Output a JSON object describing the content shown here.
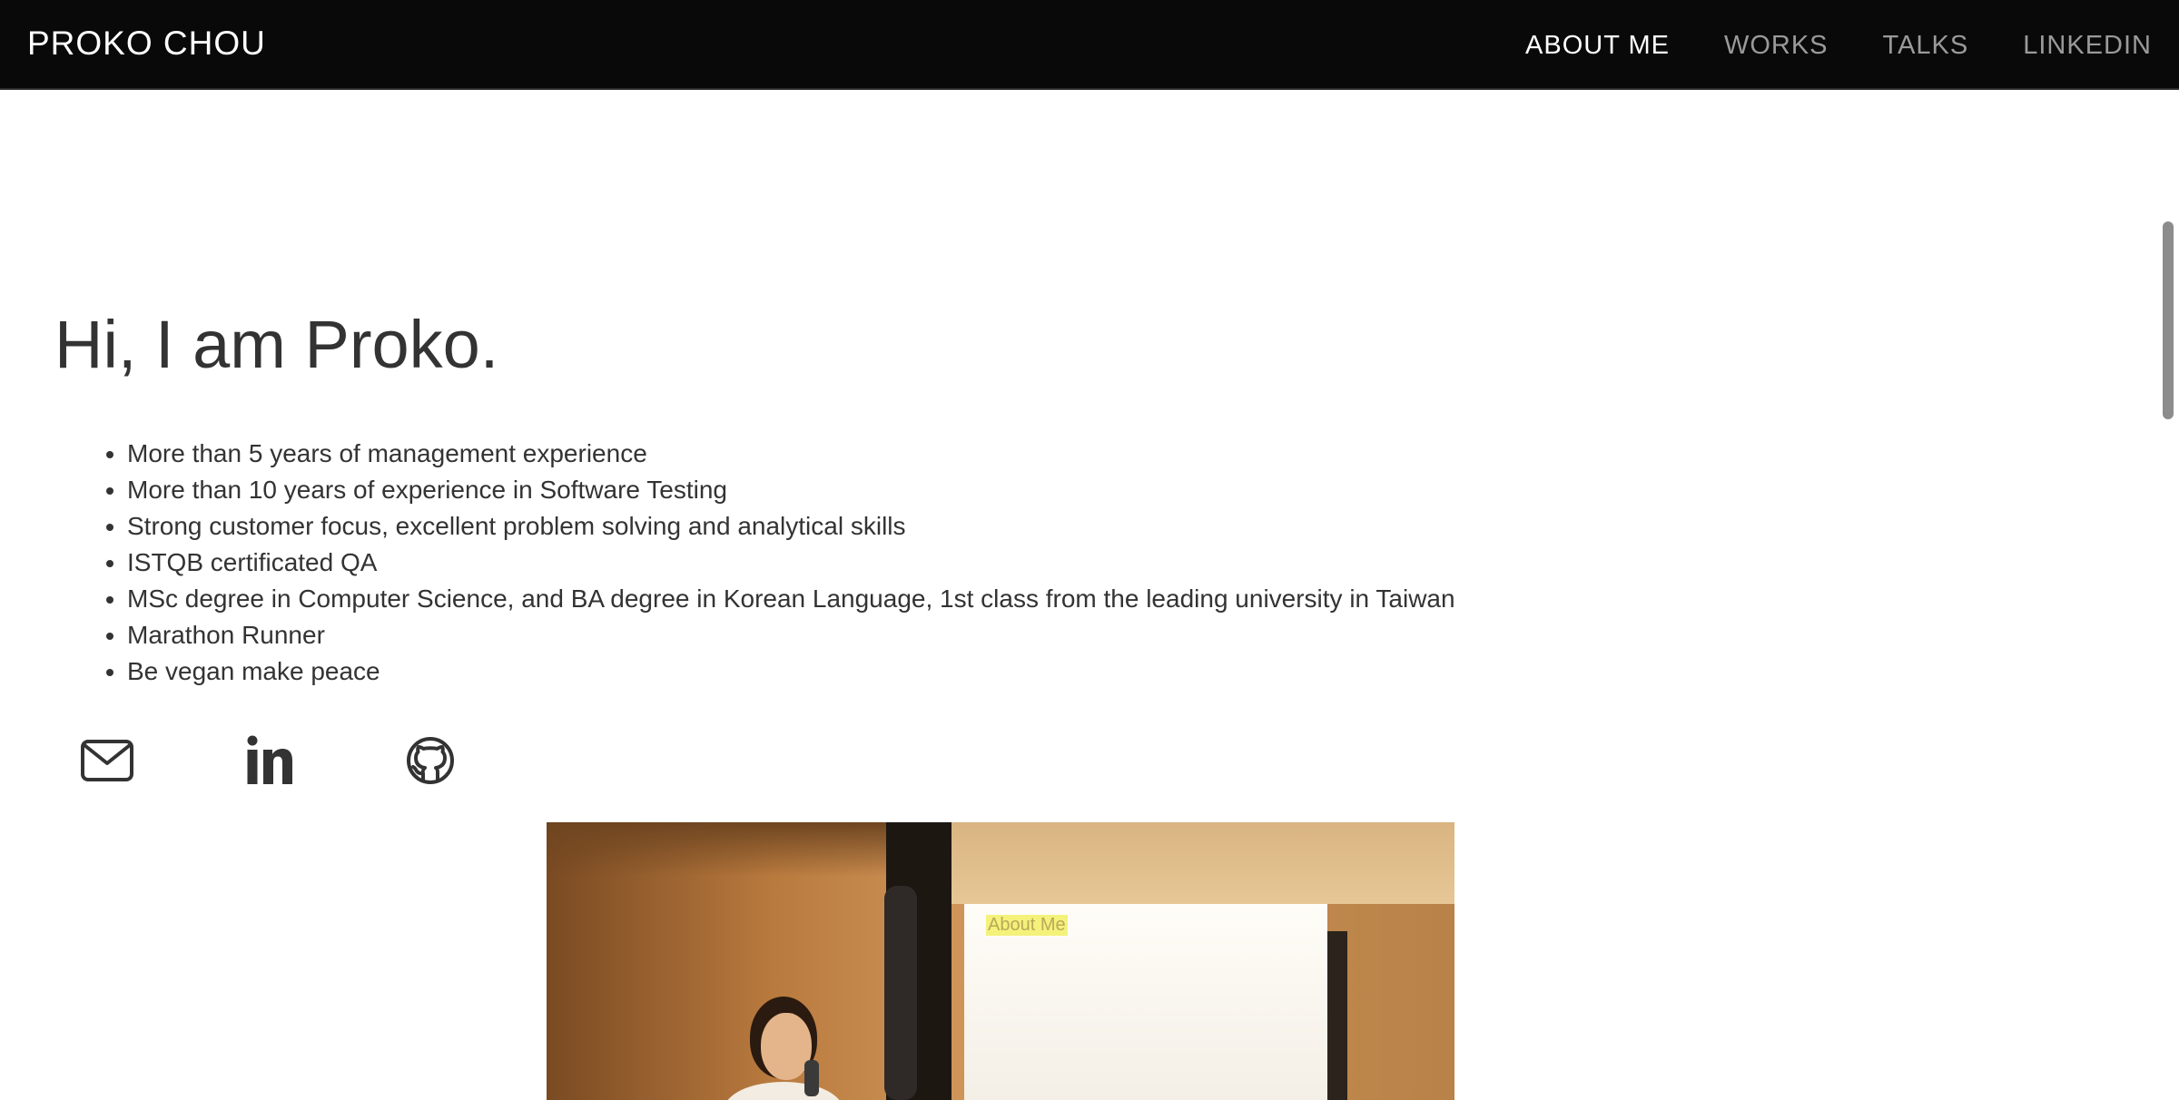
{
  "header": {
    "brand": "PROKO CHOU",
    "nav": [
      {
        "label": "ABOUT ME",
        "active": true
      },
      {
        "label": "WORKS",
        "active": false
      },
      {
        "label": "TALKS",
        "active": false
      },
      {
        "label": "LINKEDIN",
        "active": false
      }
    ]
  },
  "main": {
    "headline": "Hi, I am Proko.",
    "bullets": [
      "More than 5 years of management experience",
      "More than 10 years of experience in Software Testing",
      "Strong customer focus, excellent problem solving and analytical skills",
      "ISTQB certificated QA",
      "MSc degree in Computer Science, and BA degree in Korean Language, 1st class from the leading university in Taiwan",
      "Marathon Runner",
      "Be vegan make peace"
    ],
    "social_icons": [
      "envelope-icon",
      "linkedin-icon",
      "github-icon"
    ],
    "photo": {
      "slide_title": "About Me"
    }
  },
  "colors": {
    "navbar_bg": "#0a0909",
    "nav_active": "#ffffff",
    "nav_inactive": "#9a9a9a",
    "text": "#333333"
  }
}
